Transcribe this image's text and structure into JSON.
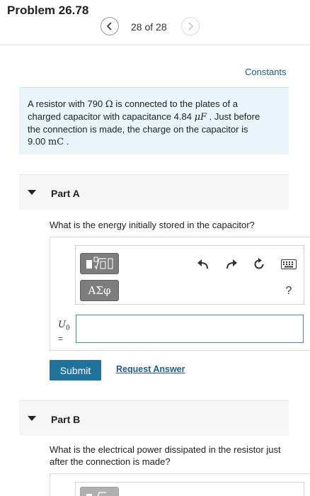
{
  "header": {
    "title": "Problem 26.78",
    "position": "28 of 28"
  },
  "links": {
    "constants": "Constants"
  },
  "problem": {
    "line1_pre": "A resistor with 790 ",
    "line1_unit": "Ω",
    "line1_post": " is connected to the plates of a",
    "line2_pre": "charged capacitor with capacitance 4.84 ",
    "line2_unit": "μF",
    "line2_post": " . Just before",
    "line3": "the connection is made, the charge on the capacitor is",
    "line4_value": "9.00 ",
    "line4_unit": "mC",
    "line4_post": " ."
  },
  "part_a": {
    "label": "Part A",
    "question": "What is the energy initially stored in the capacitor?",
    "variable": "U",
    "variable_sub": "0",
    "equals": "=",
    "greek_label": "ΑΣφ",
    "help_label": "?",
    "submit_label": "Submit",
    "request_label": "Request Answer"
  },
  "part_b": {
    "label": "Part B",
    "question": "What is the electrical power dissipated in the resistor just after the connection is made?"
  },
  "colors": {
    "accent": "#1f739a",
    "link": "#1a5f8a",
    "problem_bg": "#e9f5fa",
    "input_border": "#3d8ab3"
  }
}
